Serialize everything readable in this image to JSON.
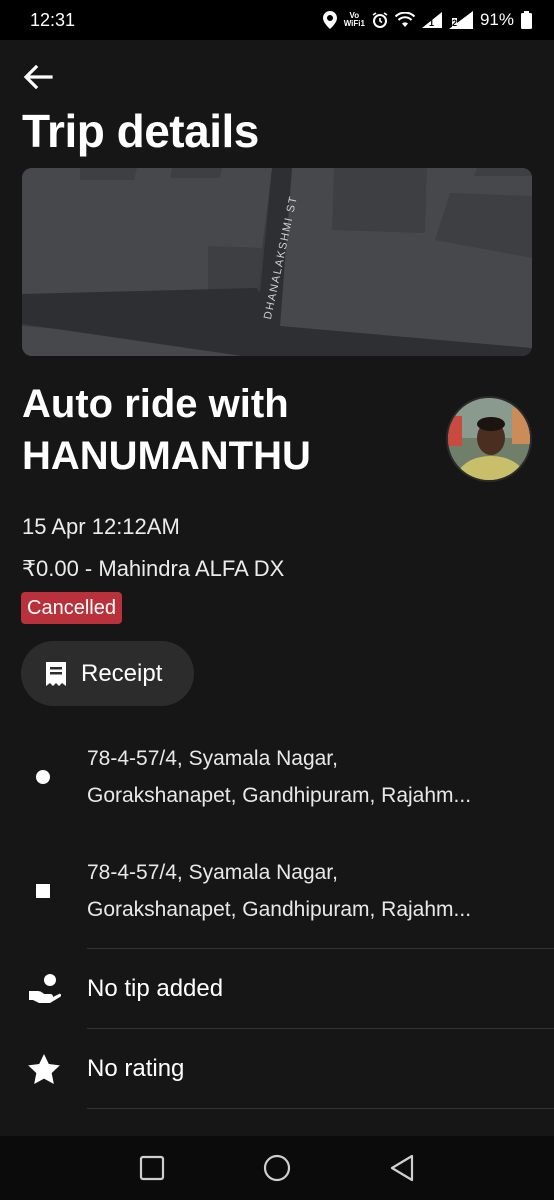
{
  "status_bar": {
    "time": "12:31",
    "vowifi_top": "Vo",
    "vowifi_bottom": "WiFi1",
    "sim1": "1",
    "sim2": "2",
    "battery": "91%"
  },
  "header": {
    "title": "Trip details"
  },
  "map": {
    "street_label": "DHANALAKSHMI ST"
  },
  "trip": {
    "title_line1": "Auto ride with",
    "title_line2": "HANUMANTHU",
    "date": "15 Apr 12:12AM",
    "fare_vehicle": "₹0.00 - Mahindra ALFA DX",
    "status": "Cancelled",
    "status_color": "#b8313b"
  },
  "actions": {
    "receipt_label": "Receipt"
  },
  "route": {
    "pickup": {
      "line1": "78-4-57/4, Syamala Nagar,",
      "line2": "Gorakshanapet, Gandhipuram, Rajahm..."
    },
    "dropoff": {
      "line1": "78-4-57/4, Syamala Nagar,",
      "line2": "Gorakshanapet, Gandhipuram, Rajahm..."
    }
  },
  "details": {
    "tip_label": "No tip added",
    "rating_label": "No rating"
  },
  "icons": {
    "back": "arrow-left-icon",
    "receipt": "receipt-icon",
    "tip": "hand-coin-icon",
    "rating": "star-icon"
  }
}
